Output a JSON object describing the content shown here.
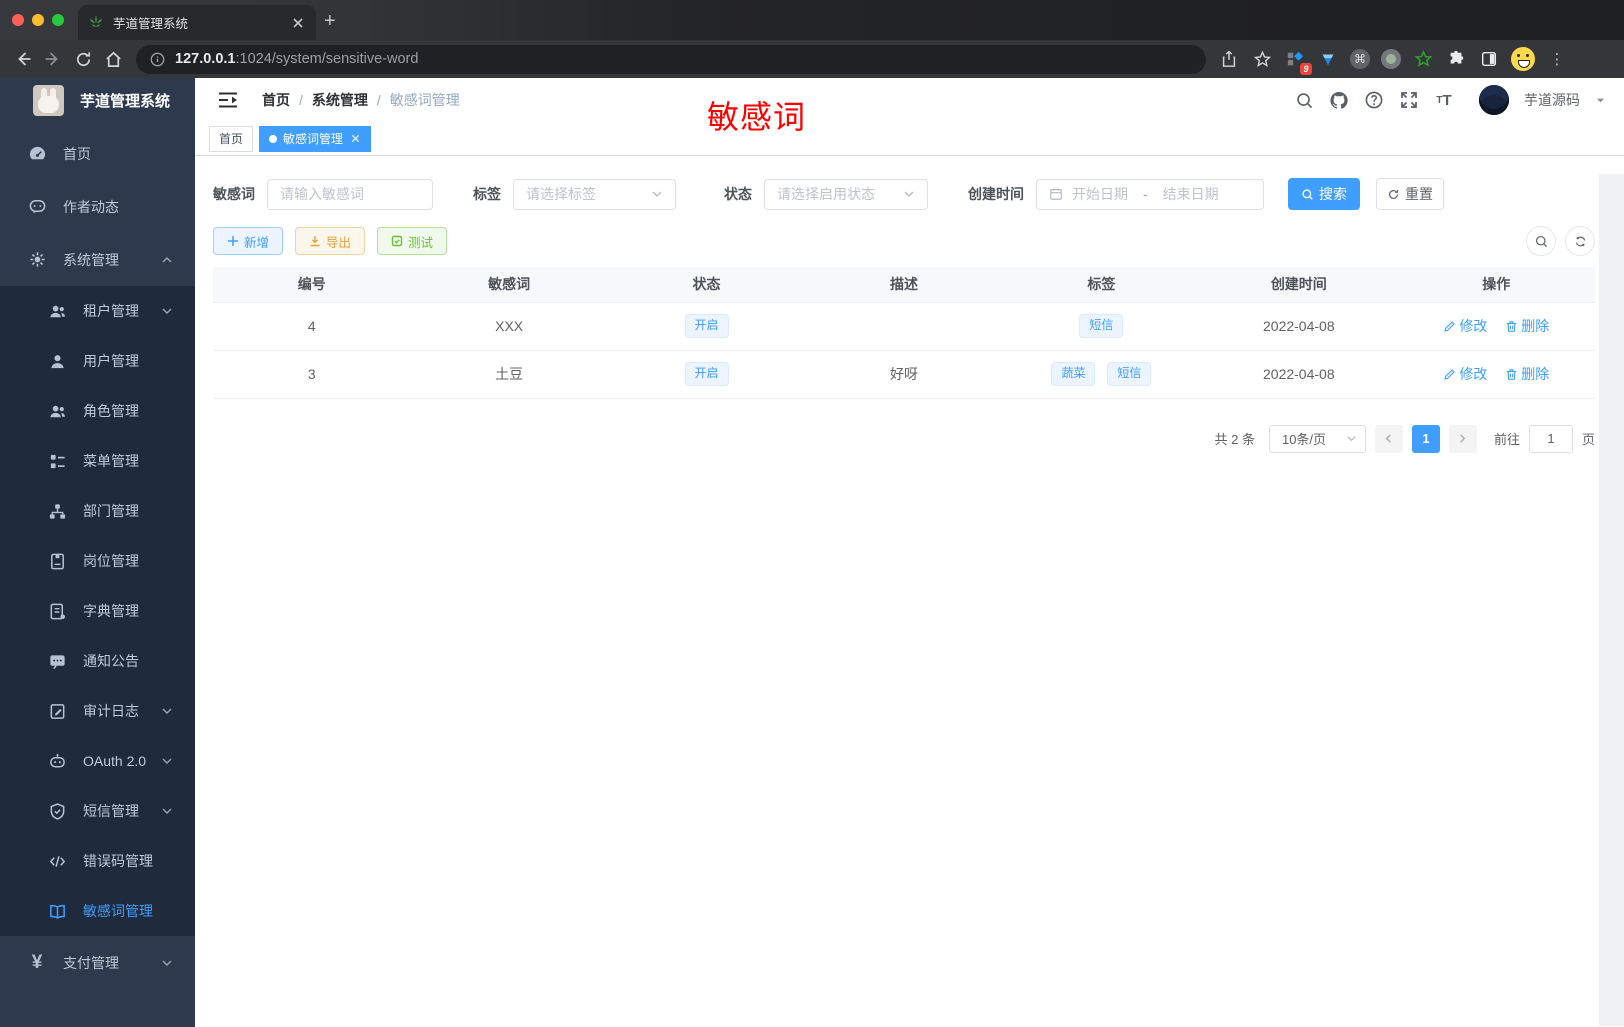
{
  "colors": {
    "accent": "#409eff",
    "warning": "#e6a23c",
    "success": "#67c23a",
    "annotation_red": "#ff0000",
    "sidebar_bg": "#2d3a4d",
    "submenu_bg": "#1f2b3d"
  },
  "browser": {
    "tab_title": "芋道管理系统",
    "url_host": "127.0.0.1",
    "url_rest": ":1024/system/sensitive-word",
    "extension_badge": "9"
  },
  "sidebar": {
    "app_title": "芋道管理系统",
    "items": [
      {
        "label": "首页"
      },
      {
        "label": "作者动态"
      },
      {
        "label": "系统管理"
      },
      {
        "label": "租户管理"
      },
      {
        "label": "用户管理"
      },
      {
        "label": "角色管理"
      },
      {
        "label": "菜单管理"
      },
      {
        "label": "部门管理"
      },
      {
        "label": "岗位管理"
      },
      {
        "label": "字典管理"
      },
      {
        "label": "通知公告"
      },
      {
        "label": "审计日志"
      },
      {
        "label": "OAuth 2.0"
      },
      {
        "label": "短信管理"
      },
      {
        "label": "错误码管理"
      },
      {
        "label": "敏感词管理"
      },
      {
        "label": "支付管理"
      }
    ]
  },
  "header": {
    "breadcrumb": [
      "首页",
      "系统管理",
      "敏感词管理"
    ],
    "breadcrumb_sep": "/",
    "user_name": "芋道源码"
  },
  "tabs": {
    "items": [
      {
        "label": "首页"
      },
      {
        "label": "敏感词管理"
      }
    ]
  },
  "annotation": "敏感词",
  "filters": {
    "keyword_label": "敏感词",
    "keyword_placeholder": "请输入敏感词",
    "tag_label": "标签",
    "tag_placeholder": "请选择标签",
    "status_label": "状态",
    "status_placeholder": "请选择启用状态",
    "date_label": "创建时间",
    "date_start": "开始日期",
    "date_sep": "-",
    "date_end": "结束日期",
    "search_label": "搜索",
    "reset_label": "重置"
  },
  "toolbar": {
    "add_label": "新增",
    "export_label": "导出",
    "test_label": "测试"
  },
  "table": {
    "headers": [
      "编号",
      "敏感词",
      "状态",
      "描述",
      "标签",
      "创建时间",
      "操作"
    ],
    "rows": [
      {
        "id": "4",
        "word": "XXX",
        "status": "开启",
        "desc": "",
        "tags": [
          "短信"
        ],
        "created": "2022-04-08",
        "edit": "修改",
        "delete": "删除"
      },
      {
        "id": "3",
        "word": "土豆",
        "status": "开启",
        "desc": "好呀",
        "tags": [
          "蔬菜",
          "短信"
        ],
        "created": "2022-04-08",
        "edit": "修改",
        "delete": "删除"
      }
    ]
  },
  "pagination": {
    "total": "共 2 条",
    "page_size": "10条/页",
    "current_page": "1",
    "goto_label": "前往",
    "goto_value": "1",
    "page_label": "页"
  }
}
